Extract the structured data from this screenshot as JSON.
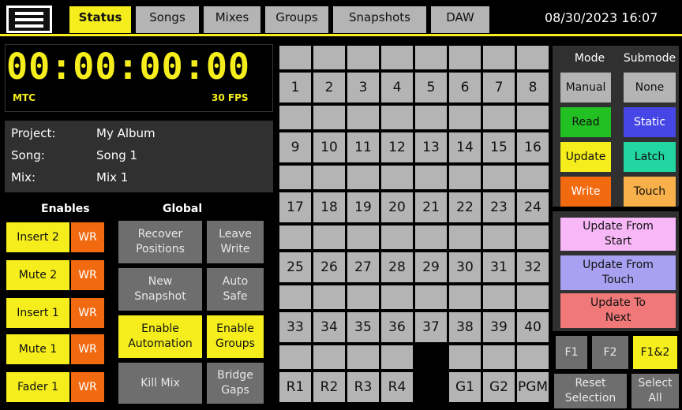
{
  "topbar": {
    "tabs": [
      {
        "label": "Status",
        "active": true
      },
      {
        "label": "Songs",
        "active": false
      },
      {
        "label": "Mixes",
        "active": false
      },
      {
        "label": "Groups",
        "active": false
      },
      {
        "label": "Snapshots",
        "active": false
      },
      {
        "label": "DAW",
        "active": false
      }
    ],
    "datetime": "08/30/2023 16:07"
  },
  "mtc": {
    "time": "00:00:00:00",
    "label": "MTC",
    "fps": "30 FPS"
  },
  "info": {
    "project_key": "Project:",
    "project_val": "My Album",
    "song_key": "Song:",
    "song_val": "Song 1",
    "mix_key": "Mix:",
    "mix_val": "Mix 1"
  },
  "enables": {
    "header": "Enables",
    "rows": [
      {
        "label": "Insert 2",
        "wr": "WR"
      },
      {
        "label": "Mute 2",
        "wr": "WR"
      },
      {
        "label": "Insert 1",
        "wr": "WR"
      },
      {
        "label": "Mute 1",
        "wr": "WR"
      },
      {
        "label": "Fader 1",
        "wr": "WR"
      }
    ]
  },
  "global": {
    "header": "Global",
    "recover_positions": "Recover Positions",
    "leave_write": "Leave Write",
    "new_snapshot": "New Snapshot",
    "auto_safe": "Auto Safe",
    "enable_automation": "Enable Automation",
    "enable_groups": "Enable Groups",
    "kill_mix": "Kill Mix",
    "bridge_gaps": "Bridge Gaps"
  },
  "tracks": {
    "rows": [
      [
        "1",
        "2",
        "3",
        "4",
        "5",
        "6",
        "7",
        "8"
      ],
      [
        "9",
        "10",
        "11",
        "12",
        "13",
        "14",
        "15",
        "16"
      ],
      [
        "17",
        "18",
        "19",
        "20",
        "21",
        "22",
        "23",
        "24"
      ],
      [
        "25",
        "26",
        "27",
        "28",
        "29",
        "30",
        "31",
        "32"
      ],
      [
        "33",
        "34",
        "35",
        "36",
        "37",
        "38",
        "39",
        "40"
      ],
      [
        "R1",
        "R2",
        "R3",
        "R4",
        "",
        "G1",
        "G2",
        "PGM"
      ]
    ]
  },
  "mode": {
    "header": "Mode",
    "manual": "Manual",
    "read": "Read",
    "update": "Update",
    "write": "Write"
  },
  "submode": {
    "header": "Submode",
    "none": "None",
    "static": "Static",
    "latch": "Latch",
    "touch": "Touch"
  },
  "update_actions": {
    "from_start": "Update From Start",
    "from_touch": "Update From Touch",
    "to_next": "Update To Next"
  },
  "fkeys": {
    "f1": "F1",
    "f2": "F2",
    "f1f2": "F1&2"
  },
  "bottom": {
    "reset_selection": "Reset Selection",
    "select_all": "Select All"
  },
  "colors": {
    "accent_yellow": "#f5ee1c",
    "wr_orange": "#f26a10",
    "read_green": "#22c022",
    "static_blue": "#4646e6",
    "latch_teal": "#22d6a2",
    "touch_orange": "#f8b04a",
    "update_from_start": "#f8b8f8",
    "update_from_touch": "#a8a0f0",
    "update_to_next": "#f07878"
  }
}
